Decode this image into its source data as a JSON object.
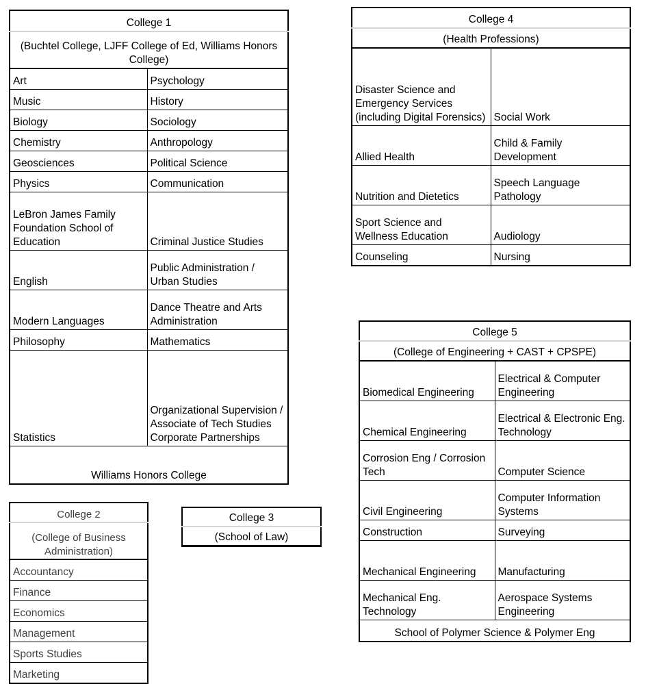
{
  "college1": {
    "title": "College 1",
    "subtitle": "(Buchtel College, LJFF College of Ed, Williams Honors College)",
    "rows": [
      {
        "left": "Art",
        "right": "Psychology"
      },
      {
        "left": "Music",
        "right": "History"
      },
      {
        "left": "Biology",
        "right": "Sociology"
      },
      {
        "left": "Chemistry",
        "right": "Anthropology"
      },
      {
        "left": "Geosciences",
        "right": "Political Science"
      },
      {
        "left": "Physics",
        "right": "Communication"
      },
      {
        "left": "LeBron James Family Foundation School of Education",
        "right": "Criminal Justice Studies"
      },
      {
        "left": "English",
        "right": "Public Administration / Urban Studies"
      },
      {
        "left": "Modern Languages",
        "right": "Dance Theatre and Arts Administration"
      },
      {
        "left": "Philosophy",
        "right": "Mathematics"
      },
      {
        "left": "Statistics",
        "right": "Organizational Supervision / Associate of Tech Studies Corporate Partnerships"
      }
    ],
    "footer": "Williams Honors College"
  },
  "college2": {
    "title": "College 2",
    "subtitle": "(College of Business Administration)",
    "rows": [
      {
        "left": "Accountancy"
      },
      {
        "left": "Finance"
      },
      {
        "left": "Economics"
      },
      {
        "left": "Management"
      },
      {
        "left": "Sports Studies"
      },
      {
        "left": "Marketing"
      }
    ]
  },
  "college3": {
    "title": "College 3",
    "subtitle": "(School of Law)"
  },
  "college4": {
    "title": "College 4",
    "subtitle": "(Health Professions)",
    "rows": [
      {
        "left": "Disaster Science and Emergency Services (including Digital Forensics)",
        "right": "Social Work"
      },
      {
        "left": "Allied Health",
        "right": "Child & Family Development"
      },
      {
        "left": "Nutrition and Dietetics",
        "right": "Speech Language Pathology"
      },
      {
        "left": "Sport Science and Wellness Education",
        "right": "Audiology"
      },
      {
        "left": "Counseling",
        "right": "Nursing"
      }
    ]
  },
  "college5": {
    "title": "College 5",
    "subtitle": "(College of Engineering + CAST + CPSPE)",
    "rows": [
      {
        "left": "Biomedical Engineering",
        "right": "Electrical & Computer Engineering"
      },
      {
        "left": "Chemical Engineering",
        "right": "Electrical & Electronic Eng. Technology"
      },
      {
        "left": "Corrosion Eng / Corrosion Tech",
        "right": "Computer Science"
      },
      {
        "left": "Civil Engineering",
        "right": "Computer Information Systems"
      },
      {
        "left": "Construction",
        "right": "Surveying"
      },
      {
        "left": "Mechanical Engineering",
        "right": "Manufacturing"
      },
      {
        "left": "Mechanical Eng. Technology",
        "right": "Aerospace Systems Engineering"
      }
    ],
    "footer": "School of Polymer Science & Polymer Eng"
  },
  "colors": {
    "border": "#000000",
    "title_divider": "#d4d4d4",
    "text": "#000000",
    "muted_text": "#3f3f3f",
    "background": "#ffffff"
  }
}
